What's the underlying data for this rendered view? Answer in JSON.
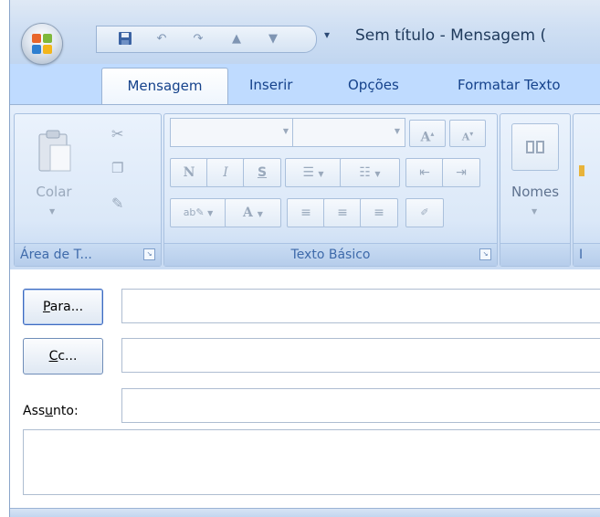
{
  "window": {
    "title": "Sem título - Mensagem (",
    "qat_customize_icon": "dropdown-arrow-icon"
  },
  "tabs": [
    {
      "label": "Mensagem",
      "active": true
    },
    {
      "label": "Inserir"
    },
    {
      "label": "Opções"
    },
    {
      "label": "Formatar Texto"
    }
  ],
  "ribbon": {
    "clipboard": {
      "label": "Área de T...",
      "paste_label": "Colar",
      "launcher_icon": "dialog-launcher-icon"
    },
    "basic_text": {
      "label": "Texto Básico",
      "bold_glyph": "N",
      "italic_glyph": "I",
      "underline_glyph": "S",
      "grow_font_glyph": "A",
      "shrink_font_glyph": "A",
      "font_color_glyph": "A",
      "highlight_glyph": "ab"
    },
    "names": {
      "label": "Nomes",
      "partial_next_label": "I"
    }
  },
  "compose": {
    "to_button": {
      "prefix": "P",
      "rest": "ara..."
    },
    "cc_button": {
      "prefix": "C",
      "rest": "c..."
    },
    "subject_label": {
      "pre": "Ass",
      "underlined": "u",
      "post": "nto:"
    },
    "to_value": "",
    "cc_value": "",
    "subject_value": "",
    "body_value": ""
  },
  "colors": {
    "ribbon_bg": "#dbe8f8",
    "tab_text": "#15428b",
    "group_label": "#3e6aaa"
  }
}
